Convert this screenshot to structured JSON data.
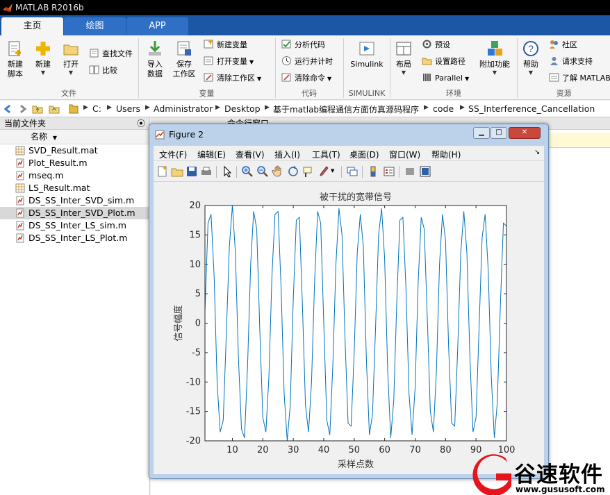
{
  "window": {
    "title": "MATLAB R2016b"
  },
  "tabs": [
    {
      "label": "主页",
      "active": true
    },
    {
      "label": "绘图",
      "active": false
    },
    {
      "label": "APP",
      "active": false
    }
  ],
  "ribbon": {
    "file": {
      "new_script": "新建\n脚本",
      "new": "新建",
      "open": "打开",
      "find_files": "查找文件",
      "compare": "比较",
      "group": "文件"
    },
    "variable": {
      "import": "导入\n数据",
      "save_ws": "保存\n工作区",
      "new_var": "新建变量",
      "open_var": "打开变量",
      "clear_ws": "清除工作区",
      "group": "变量"
    },
    "code": {
      "analyze": "分析代码",
      "run_time": "运行并计时",
      "clear_cmd": "清除命令",
      "group": "代码"
    },
    "simulink": {
      "label": "Simulink",
      "group": "SIMULINK"
    },
    "env": {
      "layout": "布局",
      "prefs": "预设",
      "set_path": "设置路径",
      "parallel": "Parallel",
      "addons": "附加功能",
      "group": "环境"
    },
    "resources": {
      "help": "帮助",
      "community": "社区",
      "support": "请求支持",
      "learn": "了解 MATLAB",
      "group": "资源"
    }
  },
  "address": {
    "crumbs": [
      "C:",
      "Users",
      "Administrator",
      "Desktop",
      "基于matlab编程通信方面仿真源码程序",
      "code",
      "SS_Interference_Cancellation"
    ]
  },
  "filepanel": {
    "title": "当前文件夹",
    "col_name": "名称",
    "files": [
      {
        "name": "SVD_Result.mat",
        "type": "mat",
        "selected": false
      },
      {
        "name": "Plot_Result.m",
        "type": "m",
        "selected": false
      },
      {
        "name": "mseq.m",
        "type": "m",
        "selected": false
      },
      {
        "name": "LS_Result.mat",
        "type": "mat",
        "selected": false
      },
      {
        "name": "DS_SS_Inter_SVD_sim.m",
        "type": "m",
        "selected": false
      },
      {
        "name": "DS_SS_Inter_SVD_Plot.m",
        "type": "m",
        "selected": true
      },
      {
        "name": "DS_SS_Inter_LS_sim.m",
        "type": "m",
        "selected": false
      },
      {
        "name": "DS_SS_Inter_LS_Plot.m",
        "type": "m",
        "selected": false
      }
    ]
  },
  "cmdpanel": {
    "title": "命令行窗口"
  },
  "figure": {
    "title": "Figure 2",
    "menus": [
      "文件(F)",
      "编辑(E)",
      "查看(V)",
      "插入(I)",
      "工具(T)",
      "桌面(D)",
      "窗口(W)",
      "帮助(H)"
    ]
  },
  "chart_data": {
    "type": "line",
    "title": "被干扰的宽带信号",
    "xlabel": "采样点数",
    "ylabel": "信号幅度",
    "xlim": [
      1,
      100
    ],
    "ylim": [
      -20,
      20
    ],
    "xticks": [
      10,
      20,
      30,
      40,
      50,
      60,
      70,
      80,
      90,
      100
    ],
    "yticks": [
      -20,
      -15,
      -10,
      -5,
      0,
      5,
      10,
      15,
      20
    ],
    "grid": false,
    "series": [
      {
        "color": "#0072bd",
        "x": [
          1,
          2,
          3,
          4,
          5,
          6,
          7,
          8,
          9,
          10,
          11,
          12,
          13,
          14,
          15,
          16,
          17,
          18,
          19,
          20,
          21,
          22,
          23,
          24,
          25,
          26,
          27,
          28,
          29,
          30,
          31,
          32,
          33,
          34,
          35,
          36,
          37,
          38,
          39,
          40,
          41,
          42,
          43,
          44,
          45,
          46,
          47,
          48,
          49,
          50,
          51,
          52,
          53,
          54,
          55,
          56,
          57,
          58,
          59,
          60,
          61,
          62,
          63,
          64,
          65,
          66,
          67,
          68,
          69,
          70,
          71,
          72,
          73,
          74,
          75,
          76,
          77,
          78,
          79,
          80,
          81,
          82,
          83,
          84,
          85,
          86,
          87,
          88,
          89,
          90,
          91,
          92,
          93,
          94,
          95,
          96,
          97,
          98,
          99,
          100
        ],
        "y": [
          2.0,
          17.0,
          18.5,
          8.0,
          -10.0,
          -18.5,
          -16.5,
          -2.0,
          13.0,
          20.0,
          12.0,
          -6.0,
          -18.0,
          -19.5,
          -7.0,
          10.0,
          19.0,
          16.0,
          -1.0,
          -16.0,
          -18.5,
          -9.0,
          8.0,
          18.5,
          19.0,
          6.0,
          -12.0,
          -20.5,
          -14.0,
          4.0,
          17.5,
          18.0,
          3.0,
          -14.0,
          -18.5,
          -10.0,
          7.0,
          19.0,
          17.0,
          0.0,
          -16.5,
          -19.0,
          -7.0,
          10.0,
          19.5,
          15.0,
          -3.0,
          -17.0,
          -17.5,
          -5.0,
          12.0,
          18.5,
          13.0,
          -6.0,
          -19.0,
          -15.5,
          -1.0,
          15.0,
          19.5,
          11.0,
          -8.0,
          -19.5,
          -13.0,
          4.0,
          17.5,
          18.0,
          6.0,
          -12.0,
          -19.0,
          -11.0,
          7.0,
          18.0,
          16.0,
          1.0,
          -15.0,
          -18.5,
          -8.0,
          10.0,
          18.5,
          14.0,
          -4.0,
          -17.0,
          -17.5,
          -4.0,
          12.0,
          19.0,
          12.0,
          -6.0,
          -18.5,
          -16.0,
          -1.0,
          14.5,
          18.5,
          9.0,
          -9.0,
          -19.5,
          -13.5,
          3.0,
          17.0,
          16.5
        ]
      }
    ]
  },
  "watermark": {
    "brand": "谷速软件",
    "url": "www.gususoft.com"
  }
}
